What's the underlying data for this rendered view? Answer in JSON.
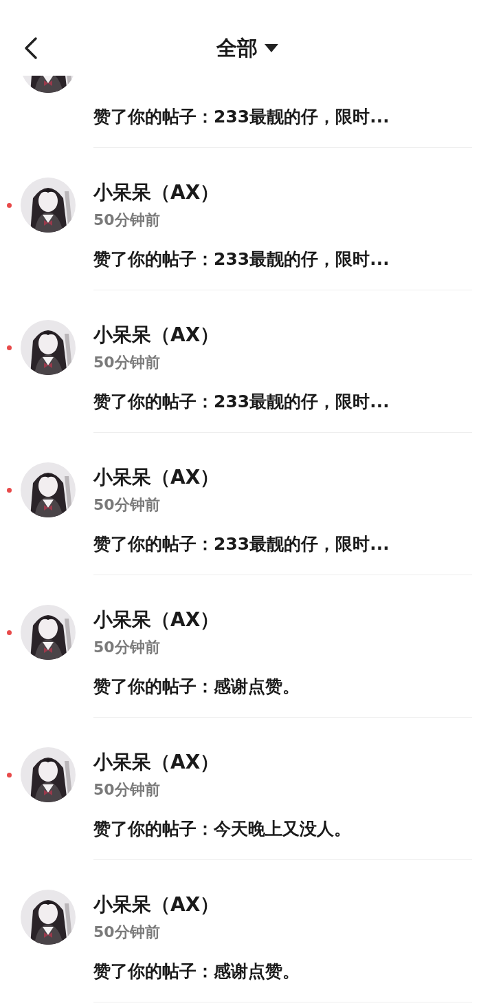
{
  "header": {
    "title": "全部"
  },
  "notifications": [
    {
      "kind": "partial",
      "message": "赞了你的帖子：233最靓的仔，限时...",
      "unread": false
    },
    {
      "kind": "full",
      "name": "小呆呆（AX）",
      "time": "50分钟前",
      "message": "赞了你的帖子：233最靓的仔，限时...",
      "unread": true
    },
    {
      "kind": "full",
      "name": "小呆呆（AX）",
      "time": "50分钟前",
      "message": "赞了你的帖子：233最靓的仔，限时...",
      "unread": true
    },
    {
      "kind": "full",
      "name": "小呆呆（AX）",
      "time": "50分钟前",
      "message": "赞了你的帖子：233最靓的仔，限时...",
      "unread": true
    },
    {
      "kind": "full",
      "name": "小呆呆（AX）",
      "time": "50分钟前",
      "message": "赞了你的帖子：感谢点赞。",
      "unread": true
    },
    {
      "kind": "full",
      "name": "小呆呆（AX）",
      "time": "50分钟前",
      "message": "赞了你的帖子：今天晚上又没人。",
      "unread": true
    },
    {
      "kind": "full",
      "name": "小呆呆（AX）",
      "time": "50分钟前",
      "message": "赞了你的帖子：感谢点赞。",
      "unread": false
    }
  ]
}
